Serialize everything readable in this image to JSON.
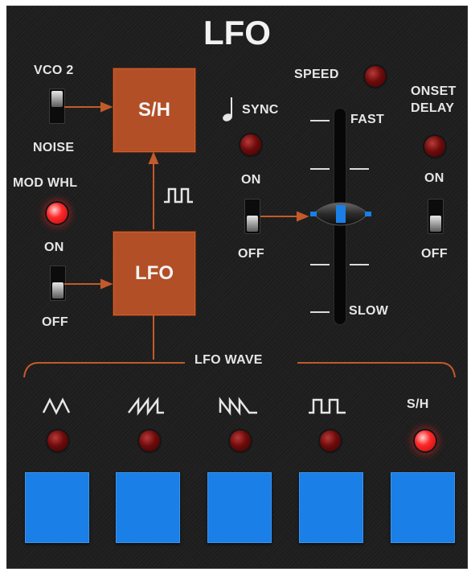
{
  "title": "LFO",
  "source_switch": {
    "top_label": "VCO 2",
    "bottom_label": "NOISE"
  },
  "sh_box": {
    "label": "S/H"
  },
  "lfo_box": {
    "label": "LFO"
  },
  "mod_wheel": {
    "label": "MOD WHL",
    "on_label": "ON",
    "off_label": "OFF",
    "led_on": true
  },
  "sync": {
    "label": "SYNC",
    "on_label": "ON",
    "off_label": "OFF",
    "led_on": false
  },
  "speed": {
    "label": "SPEED",
    "fast_label": "FAST",
    "slow_label": "SLOW",
    "led_on": false
  },
  "onset_delay": {
    "label_line1": "ONSET",
    "label_line2": "DELAY",
    "on_label": "ON",
    "off_label": "OFF",
    "led_on": false
  },
  "lfo_wave": {
    "label": "LFO WAVE",
    "sh_label": "S/H",
    "waves": [
      {
        "icon": "triangle-wave-icon",
        "led_on": false
      },
      {
        "icon": "sawtooth-up-wave-icon",
        "led_on": false
      },
      {
        "icon": "sawtooth-down-wave-icon",
        "led_on": false
      },
      {
        "icon": "square-wave-icon",
        "led_on": false
      },
      {
        "icon": "sample-hold-label",
        "led_on": true
      }
    ]
  },
  "colors": {
    "panel": "#1f1f1f",
    "accent_orange": "#b24f26",
    "button_blue": "#1a7fe6",
    "led_red": "#ff2a2a"
  }
}
